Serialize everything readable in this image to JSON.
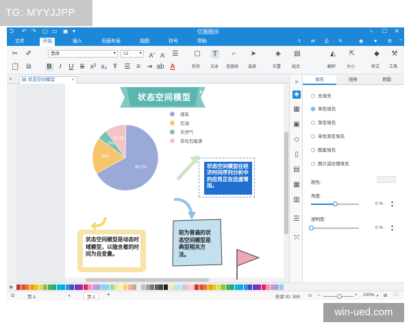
{
  "watermark": {
    "top": "TG: MYYJJPP",
    "bottom": "win-ued.com"
  },
  "app": {
    "title": "亿图图示"
  },
  "menu": [
    {
      "label": "文件"
    },
    {
      "label": "开始"
    },
    {
      "label": "插入"
    },
    {
      "label": "页面布局"
    },
    {
      "label": "视图"
    },
    {
      "label": "符号"
    },
    {
      "label": "帮助"
    }
  ],
  "ribbon": {
    "font": "黑体",
    "size": "12",
    "labels": {
      "shape": "形状",
      "text": "文本",
      "connector": "连接线",
      "select": "选择",
      "position": "位置",
      "group": "组合",
      "rotate": "翻转",
      "size": "大小",
      "style": "样式",
      "tools": "工具"
    }
  },
  "doc_tab": "状态空间模型",
  "diagram": {
    "title": "状态空间模型",
    "legend": [
      {
        "label": "煤炭",
        "color": "#9aa9d8"
      },
      {
        "label": "石油",
        "color": "#f5c66c"
      },
      {
        "label": "天然气",
        "color": "#79c2b1"
      },
      {
        "label": "非化石能源",
        "color": "#f3c4c7"
      }
    ],
    "text_right": "状态空间模型在经济时间序列分析中的应用正在迅速增加。",
    "text_left": "状态空间模型是动态时域模型，以隐含着的时间为自变量。",
    "text_mid": "较为普遍的状态空间模型是典型相关方法。"
  },
  "chart_data": {
    "type": "pie",
    "categories": [
      "煤炭",
      "石油",
      "天然气",
      "非化石能源"
    ],
    "values": [
      66.7,
      18,
      5,
      10.3
    ],
    "data_labels": [
      "66.7%",
      "18%",
      "5%",
      "10.3%"
    ],
    "colors": [
      "#9aa9d8",
      "#f5c66c",
      "#79c2b1",
      "#f3c4c7"
    ]
  },
  "panel": {
    "tabs": [
      {
        "label": "填充"
      },
      {
        "label": "线条"
      },
      {
        "label": "阴影"
      }
    ],
    "options": [
      {
        "label": "无填充",
        "selected": false
      },
      {
        "label": "单色填充",
        "selected": true
      },
      {
        "label": "渐变填充",
        "selected": false
      },
      {
        "label": "单色渐变填充",
        "selected": false
      },
      {
        "label": "图案填充",
        "selected": false
      },
      {
        "label": "图片或纹理填充",
        "selected": false
      }
    ],
    "color_label": "颜色:",
    "brightness_label": "亮度:",
    "brightness_value": "0 %",
    "brightness": 0.5,
    "transparency_label": "透明度:",
    "transparency_value": "0 %",
    "transparency": 0.0
  },
  "status": {
    "page_label_left": "页-1",
    "page_tab": "页-1",
    "add": "+",
    "shape_id": "形状 ID: 309",
    "zoom": "100%"
  }
}
